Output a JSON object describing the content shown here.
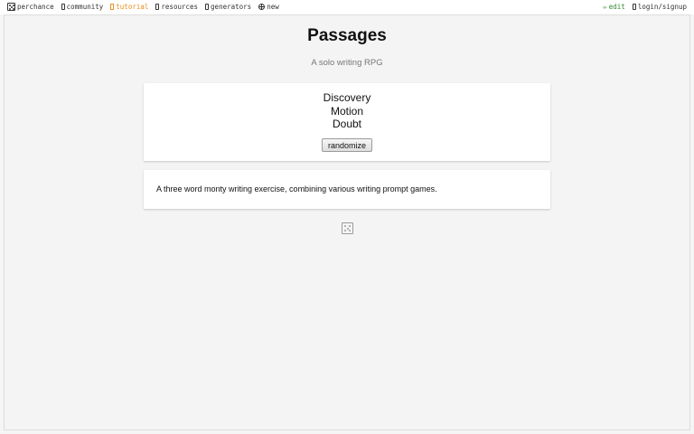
{
  "topbar": {
    "items": [
      {
        "label": "perchance",
        "icon": "perchance-logo-icon"
      },
      {
        "label": "community",
        "icon": "chat-icon"
      },
      {
        "label": "tutorial",
        "icon": "book-icon"
      },
      {
        "label": "resources",
        "icon": "folder-icon"
      },
      {
        "label": "generators",
        "icon": "grid-icon"
      },
      {
        "label": "new",
        "icon": "globe-icon"
      }
    ],
    "edit_label": "edit",
    "login_label": "login/signup"
  },
  "page": {
    "title": "Passages",
    "subtitle": "A solo writing RPG"
  },
  "output": {
    "words": [
      "Discovery",
      "Motion",
      "Doubt"
    ],
    "randomize_label": "randomize"
  },
  "description": "A three word monty writing exercise, combining various writing prompt games.",
  "colors": {
    "accent_tutorial": "#e88b1c",
    "edit_green": "#2e8b2e",
    "background": "#f4f4f4"
  }
}
